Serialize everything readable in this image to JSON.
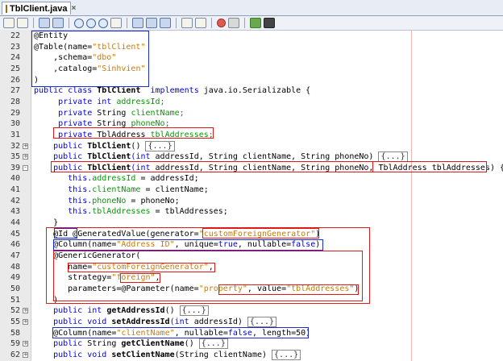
{
  "tab": {
    "title": "TblClient.java",
    "close": "×"
  },
  "toolbar": {
    "icons": [
      "source-icon",
      "history-icon",
      "back-icon",
      "forward-icon",
      "find-icon",
      "find-previous-icon",
      "find-next-icon",
      "toggle-highlight-icon",
      "prev-bookmark-icon",
      "next-bookmark-icon",
      "toggle-bookmark-icon",
      "shift-left-icon",
      "shift-right-icon",
      "record-macro-icon",
      "stop-macro-icon",
      "comment-icon",
      "uncomment-icon"
    ]
  },
  "lines": [
    {
      "n": "22",
      "fold": "",
      "segs": [
        [
          "@Entity",
          "ann"
        ]
      ]
    },
    {
      "n": "23",
      "fold": "",
      "segs": [
        [
          "@Table(name=",
          "ann"
        ],
        [
          "\"tblClient\"",
          "str"
        ]
      ]
    },
    {
      "n": "24",
      "fold": "",
      "segs": [
        [
          "    ,schema=",
          "ann"
        ],
        [
          "\"dbo\"",
          "str"
        ]
      ]
    },
    {
      "n": "25",
      "fold": "",
      "segs": [
        [
          "    ,catalog=",
          "ann"
        ],
        [
          "\"Sinhvien\"",
          "str"
        ]
      ]
    },
    {
      "n": "26",
      "fold": "",
      "segs": [
        [
          ")",
          "ann"
        ]
      ]
    },
    {
      "n": "27",
      "fold": "",
      "segs": [
        [
          "public class ",
          "kw"
        ],
        [
          "TblClient",
          "b"
        ],
        [
          "  implements ",
          "kw"
        ],
        [
          "java.io.Serializable {",
          ""
        ]
      ]
    },
    {
      "n": "28",
      "fold": "",
      "segs": [
        [
          "     private int ",
          "kw"
        ],
        [
          "addressId;",
          "fld"
        ]
      ]
    },
    {
      "n": "29",
      "fold": "",
      "segs": [
        [
          "     private ",
          "kw"
        ],
        [
          "String ",
          ""
        ],
        [
          "clientName;",
          "fld"
        ]
      ]
    },
    {
      "n": "30",
      "fold": "",
      "segs": [
        [
          "     private ",
          "kw"
        ],
        [
          "String ",
          ""
        ],
        [
          "phoneNo;",
          "fld"
        ]
      ]
    },
    {
      "n": "31",
      "fold": "",
      "segs": [
        [
          "     private ",
          "kw"
        ],
        [
          "TblAddress ",
          ""
        ],
        [
          "tblAddresses;",
          "fld"
        ]
      ]
    },
    {
      "n": "32",
      "fold": "+",
      "segs": [
        [
          "    public ",
          "kw"
        ],
        [
          "TblClient",
          "b"
        ],
        [
          "() ",
          ""
        ],
        [
          "{...}",
          "foldbox"
        ]
      ]
    },
    {
      "n": "35",
      "fold": "+",
      "segs": [
        [
          "    public ",
          "kw"
        ],
        [
          "TblClient",
          "b"
        ],
        [
          "(int ",
          "kw2"
        ],
        [
          "addressId, String clientName, String phoneNo) ",
          ""
        ],
        [
          "{...}",
          "foldbox"
        ]
      ]
    },
    {
      "n": "39",
      "fold": "-",
      "segs": [
        [
          "    public ",
          "kw"
        ],
        [
          "TblClient",
          "b"
        ],
        [
          "(int ",
          "kw2"
        ],
        [
          "addressId, String clientName, String phoneNo, TblAddress tblAddresses) {",
          ""
        ]
      ]
    },
    {
      "n": "40",
      "fold": "",
      "segs": [
        [
          "       this.",
          "kw"
        ],
        [
          "addressId",
          "fld"
        ],
        [
          " = addressId;",
          ""
        ]
      ]
    },
    {
      "n": "41",
      "fold": "",
      "segs": [
        [
          "       this.",
          "kw"
        ],
        [
          "clientName",
          "fld"
        ],
        [
          " = clientName;",
          ""
        ]
      ]
    },
    {
      "n": "42",
      "fold": "",
      "segs": [
        [
          "       this.",
          "kw"
        ],
        [
          "phoneNo",
          "fld"
        ],
        [
          " = phoneNo;",
          ""
        ]
      ]
    },
    {
      "n": "43",
      "fold": "",
      "segs": [
        [
          "       this.",
          "kw"
        ],
        [
          "tblAddresses",
          "fld"
        ],
        [
          " = tblAddresses;",
          ""
        ]
      ]
    },
    {
      "n": "44",
      "fold": "",
      "segs": [
        [
          "    }",
          ""
        ]
      ]
    },
    {
      "n": "45",
      "fold": "",
      "segs": [
        [
          "    @Id ",
          "ann"
        ],
        [
          "@GeneratedValue(generator=",
          "ann"
        ],
        [
          "\"customForeignGenerator\"",
          "str"
        ],
        [
          ")",
          ""
        ]
      ]
    },
    {
      "n": "46",
      "fold": "",
      "segs": [
        [
          "    @Column",
          "ann"
        ],
        [
          "(name=",
          ""
        ],
        [
          "\"Address ID\"",
          "str"
        ],
        [
          ", unique=",
          ""
        ],
        [
          "true",
          "kw"
        ],
        [
          ", nullable=",
          ""
        ],
        [
          "false",
          "kw"
        ],
        [
          ")",
          ""
        ]
      ]
    },
    {
      "n": "47",
      "fold": "",
      "segs": [
        [
          "    @GenericGenerator(",
          "ann"
        ]
      ]
    },
    {
      "n": "48",
      "fold": "",
      "segs": [
        [
          "       name=",
          ""
        ],
        [
          "\"customForeignGenerator\"",
          "str"
        ],
        [
          ",",
          ""
        ]
      ]
    },
    {
      "n": "49",
      "fold": "",
      "segs": [
        [
          "       strategy=",
          ""
        ],
        [
          "\"foreign\"",
          "str"
        ],
        [
          ",",
          ""
        ]
      ]
    },
    {
      "n": "50",
      "fold": "",
      "segs": [
        [
          "       parameters=@Parameter(name=",
          ""
        ],
        [
          "\"property\"",
          "str"
        ],
        [
          ", value=",
          ""
        ],
        [
          "\"tblAddresses\"",
          "str"
        ],
        [
          ")",
          ""
        ]
      ]
    },
    {
      "n": "51",
      "fold": "",
      "segs": [
        [
          "    )",
          ""
        ]
      ]
    },
    {
      "n": "52",
      "fold": "+",
      "segs": [
        [
          "    public int ",
          "kw"
        ],
        [
          "getAddressId",
          "b"
        ],
        [
          "() ",
          ""
        ],
        [
          "{...}",
          "foldbox"
        ]
      ]
    },
    {
      "n": "55",
      "fold": "+",
      "segs": [
        [
          "    public void ",
          "kw"
        ],
        [
          "setAddressId",
          "b"
        ],
        [
          "(int ",
          "kw2"
        ],
        [
          "addressId) ",
          ""
        ],
        [
          "{...}",
          "foldbox"
        ]
      ]
    },
    {
      "n": "58",
      "fold": "",
      "segs": [
        [
          "    @Column",
          "ann"
        ],
        [
          "(name=",
          ""
        ],
        [
          "\"clientName\"",
          "str"
        ],
        [
          ", nullable=",
          ""
        ],
        [
          "false",
          "kw"
        ],
        [
          ", length=50)",
          ""
        ]
      ]
    },
    {
      "n": "59",
      "fold": "+",
      "segs": [
        [
          "    public ",
          "kw"
        ],
        [
          "String ",
          ""
        ],
        [
          "getClientName",
          "b"
        ],
        [
          "() ",
          ""
        ],
        [
          "{...}",
          "foldbox"
        ]
      ]
    },
    {
      "n": "62",
      "fold": "+",
      "segs": [
        [
          "    public void ",
          "kw"
        ],
        [
          "setClientName",
          "b"
        ],
        [
          "(String clientName) ",
          ""
        ],
        [
          "{...}",
          "foldbox"
        ]
      ]
    }
  ]
}
